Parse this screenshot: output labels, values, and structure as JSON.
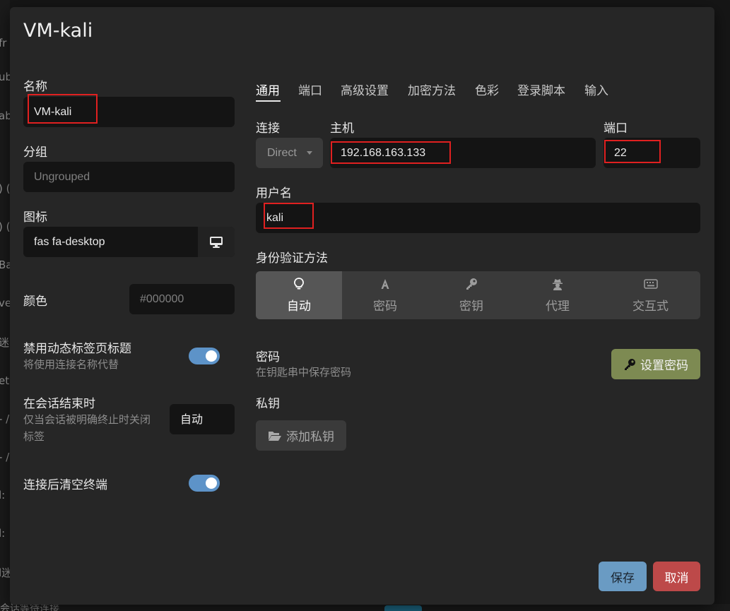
{
  "background": {
    "fragments": [
      "fr",
      "ub",
      "ab",
      ") (",
      ") (",
      "Ba",
      "ver",
      "迷",
      "et",
      "- /",
      "- /",
      "l:",
      "l:",
      "l迷"
    ],
    "bottom_text": "会话等待连接"
  },
  "modal": {
    "title": "VM-kali",
    "name": {
      "label": "名称",
      "value": "VM-kali"
    },
    "group": {
      "label": "分组",
      "placeholder": "Ungrouped"
    },
    "icon": {
      "label": "图标",
      "value": "fas fa-desktop",
      "icon": "desktop-icon"
    },
    "color": {
      "label": "颜色",
      "placeholder": "#000000"
    },
    "disable_dynamic_title": {
      "label": "禁用动态标签页标题",
      "sublabel": "将使用连接名称代替",
      "enabled": true
    },
    "on_session_end": {
      "label": "在会话结束时",
      "sublabel_line1": "仅当会话被明确终止时关闭",
      "sublabel_line2": "标签",
      "value": "自动"
    },
    "clear_terminal": {
      "label": "连接后清空终端",
      "enabled": true
    },
    "tabs": [
      "通用",
      "端口",
      "高级设置",
      "加密方法",
      "色彩",
      "登录脚本",
      "输入"
    ],
    "active_tab": "通用",
    "connection": {
      "label": "连接",
      "value": "Direct"
    },
    "host": {
      "label": "主机",
      "value": "192.168.163.133"
    },
    "port": {
      "label": "端口",
      "value": "22"
    },
    "username": {
      "label": "用户名",
      "value": "kali"
    },
    "auth": {
      "label": "身份验证方法",
      "options": [
        {
          "label": "自动",
          "icon": "lightbulb-icon",
          "active": true
        },
        {
          "label": "密码",
          "icon": "font-a-icon",
          "active": false
        },
        {
          "label": "密钥",
          "icon": "key-icon",
          "active": false
        },
        {
          "label": "代理",
          "icon": "user-secret-icon",
          "active": false
        },
        {
          "label": "交互式",
          "icon": "keyboard-icon",
          "active": false
        }
      ]
    },
    "password": {
      "label": "密码",
      "sublabel": "在钥匙串中保存密码",
      "button": "设置密码"
    },
    "private_key": {
      "label": "私钥",
      "button": "添加私钥"
    },
    "footer": {
      "save": "保存",
      "cancel": "取消"
    }
  },
  "colors": {
    "accent_blue": "#5d93c8",
    "save": "#6a9bc3",
    "cancel": "#bd4949",
    "set_password": "#7d8a52",
    "highlight_box": "#e02020"
  }
}
